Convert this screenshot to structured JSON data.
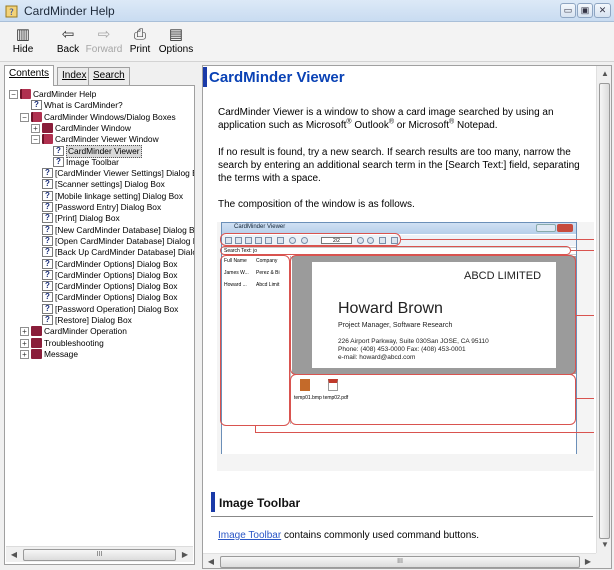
{
  "window": {
    "title": "CardMinder Help"
  },
  "toolbar": {
    "hide": "Hide",
    "back": "Back",
    "forward": "Forward",
    "print": "Print",
    "options": "Options"
  },
  "tabs": [
    "Contents",
    "Index",
    "Search"
  ],
  "tree": [
    "CardMinder Help",
    "What is CardMinder?",
    "CardMinder Windows/Dialog Boxes",
    "CardMinder Window",
    "CardMinder Viewer Window",
    "CardMinder Viewer",
    "Image Toolbar",
    "[CardMinder Viewer Settings] Dialog Box",
    "[Scanner settings] Dialog Box",
    "[Mobile linkage setting] Dialog Box",
    "[Password Entry] Dialog Box",
    "[Print] Dialog Box",
    "[New CardMinder Database] Dialog Box",
    "[Open CardMinder Database] Dialog Box",
    "[Back Up CardMinder Database] Dialog Box",
    "[CardMinder Options] Dialog Box",
    "[CardMinder Options] Dialog Box",
    "[CardMinder Options] Dialog Box",
    "[CardMinder Options] Dialog Box",
    "[Password Operation] Dialog Box",
    "[Restore] Dialog Box",
    "CardMinder Operation",
    "Troubleshooting",
    "Message"
  ],
  "tree_scroll_thumb": "III",
  "content": {
    "title": "CardMinder Viewer",
    "p1_a": "CardMinder Viewer is a window to show a card image searched by using an application such as Microsoft",
    "p1_sup1": "®",
    "p1_b": " Outlook",
    "p1_sup2": "®",
    "p1_c": " or Microsoft",
    "p1_sup3": "®",
    "p1_d": " Notepad.",
    "p2": "If no result is found, try a new search. If search results are too many, narrow the search by entering an additional search term in the [Search Text:] field, separating the terms with a space.",
    "p3": "The composition of the window is as follows.",
    "section_title": "Image Toolbar",
    "section_link": "Image Toolbar",
    "section_text": " contains commonly used command buttons.",
    "hscroll_thumb": "III"
  },
  "figure": {
    "window_title": "CardMinder Viewer",
    "pager": "2/2",
    "search_label": "Search Text: jo",
    "list_headers": [
      "Full Name",
      "Company"
    ],
    "list_rows": [
      [
        "James W...",
        "Perez & Bi"
      ],
      [
        "Howard ...",
        "Abcd Limit"
      ]
    ],
    "card": {
      "company": "ABCD LIMITED",
      "name": "Howard Brown",
      "position": "Project Manager, Software Research",
      "address": "226 Airport Parkway, Suite 030San JOSE, CA 95110",
      "phone": "Phone: (408) 453-0000     Fax: (408) 453-0001",
      "email": "e-mail: howard@abcd.com"
    },
    "files_label": "temp01.bmp  temp02.pdf"
  },
  "colors": {
    "title_blue": "#0a42b5",
    "callout_red": "#d9534f",
    "link_blue": "#2a56c6"
  }
}
